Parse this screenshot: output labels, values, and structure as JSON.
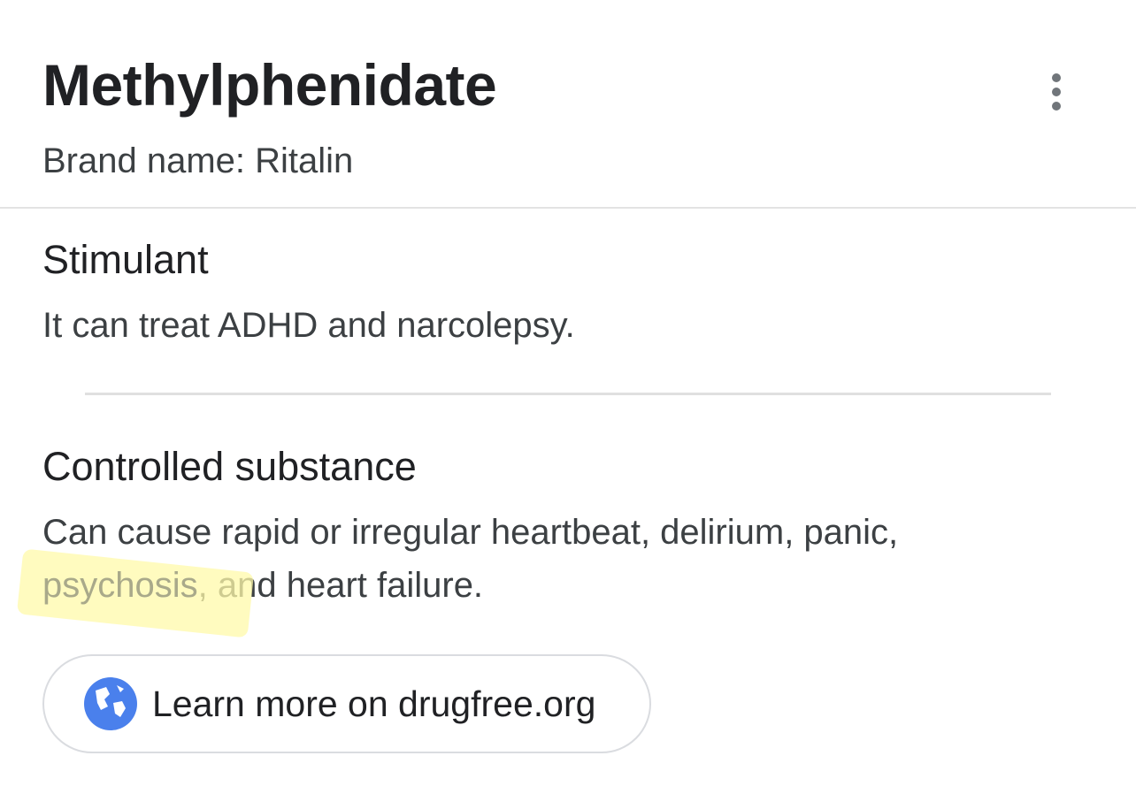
{
  "header": {
    "title": "Methylphenidate",
    "brand": "Brand name: Ritalin"
  },
  "sections": [
    {
      "title": "Stimulant",
      "text": "It can treat ADHD and narcolepsy."
    },
    {
      "title": "Controlled substance",
      "text_line1": "Can cause rapid or irregular heartbeat, delirium, panic,",
      "text_highlight": "psychosis",
      "text_line2_rest": ", and heart failure."
    }
  ],
  "learn_more": {
    "label": "Learn more on drugfree.org",
    "icon": "globe-icon"
  },
  "colors": {
    "highlight": "#fffaaa",
    "globe": "#4a80ec"
  },
  "more_menu_icon": "more-vert-icon"
}
